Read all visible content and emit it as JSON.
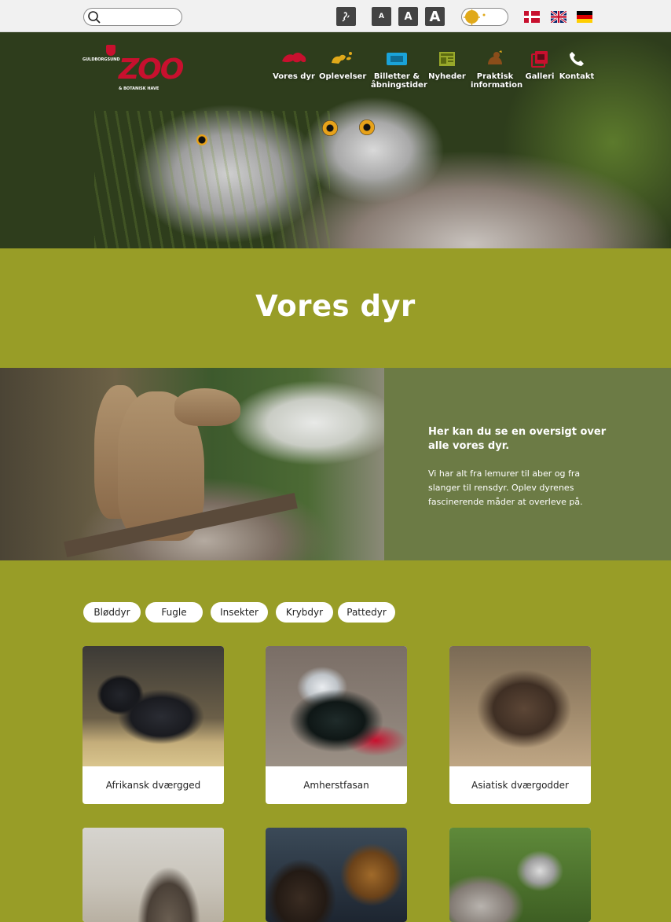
{
  "topbar": {
    "search": {
      "placeholder": "",
      "value": ""
    },
    "hearing_icon": "hearing-icon",
    "text_size_buttons": [
      "A",
      "A",
      "A"
    ],
    "contrast_toggle_icon": "sun-icon",
    "languages": [
      "da",
      "en",
      "de"
    ]
  },
  "logo": {
    "small_top": "GULDBORGSUND",
    "main": "ZOO",
    "small_bottom": "& BOTANISK HAVE"
  },
  "nav": [
    {
      "label": "Vores dyr",
      "icon": "animals-icon",
      "color": "#c8102e"
    },
    {
      "label": "Oplevelser",
      "icon": "experiences-icon",
      "color": "#e0a91a"
    },
    {
      "label": "Billetter &\nåbningstider",
      "icon": "tickets-icon",
      "color": "#1aa3d9"
    },
    {
      "label": "Nyheder",
      "icon": "news-icon",
      "color": "#98a82a"
    },
    {
      "label": "Praktisk\ninformation",
      "icon": "info-icon",
      "color": "#8a4d1a"
    },
    {
      "label": "Galleri",
      "icon": "gallery-icon",
      "color": "#c8102e"
    },
    {
      "label": "Kontakt",
      "icon": "phone-icon",
      "color": "#ffffff"
    }
  ],
  "page": {
    "title": "Vores dyr"
  },
  "intro": {
    "heading": "Her kan du se en oversigt over alle vores dyr.",
    "body": "Vi har alt fra lemurer til aber og fra slanger til rensdyr.  Oplev dyrenes fascinerende måder at overleve på."
  },
  "filters": [
    "Bløddyr",
    "Fugle",
    "Insekter",
    "Krybdyr",
    "Pattedyr"
  ],
  "animals": [
    {
      "name": "Afrikansk dværgged"
    },
    {
      "name": "Amherstfasan"
    },
    {
      "name": "Asiatisk dværgodder"
    },
    {
      "name": ""
    },
    {
      "name": ""
    },
    {
      "name": ""
    }
  ],
  "colors": {
    "brand_green": "#989d27",
    "intro_green": "#6c7b45",
    "zoo_red": "#c8102e"
  }
}
